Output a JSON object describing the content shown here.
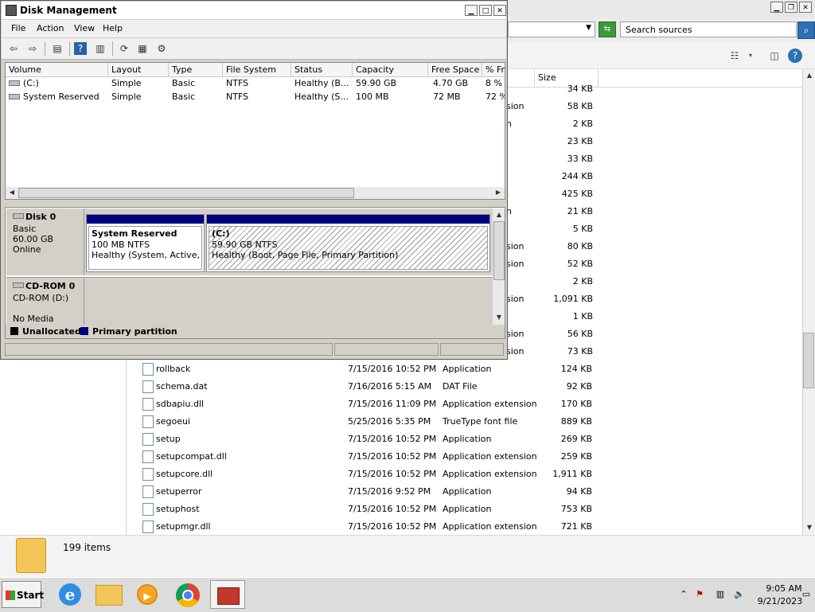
{
  "explorer": {
    "search_placeholder": "Search sources",
    "column_size": "Size",
    "item_count": "199 items",
    "side_rows": [
      {
        "type": "",
        "size": "34 KB"
      },
      {
        "type": "sion",
        "size": "58 KB"
      },
      {
        "type": "n",
        "size": "2 KB"
      },
      {
        "type": "",
        "size": "23 KB"
      },
      {
        "type": "",
        "size": "33 KB"
      },
      {
        "type": "",
        "size": "244 KB"
      },
      {
        "type": "",
        "size": "425 KB"
      },
      {
        "type": "n",
        "size": "21 KB"
      },
      {
        "type": "",
        "size": "5 KB"
      },
      {
        "type": "sion",
        "size": "80 KB"
      },
      {
        "type": "sion",
        "size": "52 KB"
      },
      {
        "type": "",
        "size": "2 KB"
      },
      {
        "type": "sion",
        "size": "1,091 KB"
      },
      {
        "type": "",
        "size": "1 KB"
      },
      {
        "type": "sion",
        "size": "56 KB"
      },
      {
        "type": "sion",
        "size": "73 KB"
      }
    ],
    "files": [
      {
        "name": "rollback",
        "date": "7/15/2016 10:52 PM",
        "type": "Application",
        "size": "124 KB"
      },
      {
        "name": "schema.dat",
        "date": "7/16/2016 5:15 AM",
        "type": "DAT File",
        "size": "92 KB"
      },
      {
        "name": "sdbapiu.dll",
        "date": "7/15/2016 11:09 PM",
        "type": "Application extension",
        "size": "170 KB"
      },
      {
        "name": "segoeui",
        "date": "5/25/2016 5:35 PM",
        "type": "TrueType font file",
        "size": "889 KB"
      },
      {
        "name": "setup",
        "date": "7/15/2016 10:52 PM",
        "type": "Application",
        "size": "269 KB"
      },
      {
        "name": "setupcompat.dll",
        "date": "7/15/2016 10:52 PM",
        "type": "Application extension",
        "size": "259 KB"
      },
      {
        "name": "setupcore.dll",
        "date": "7/15/2016 10:52 PM",
        "type": "Application extension",
        "size": "1,911 KB"
      },
      {
        "name": "setuperror",
        "date": "7/15/2016 9:52 PM",
        "type": "Application",
        "size": "94 KB"
      },
      {
        "name": "setuphost",
        "date": "7/15/2016 10:52 PM",
        "type": "Application",
        "size": "753 KB"
      },
      {
        "name": "setupmgr.dll",
        "date": "7/15/2016 10:52 PM",
        "type": "Application extension",
        "size": "721 KB"
      }
    ]
  },
  "disk_mgmt": {
    "title": "Disk Management",
    "menu": [
      "File",
      "Action",
      "View",
      "Help"
    ],
    "columns": [
      "Volume",
      "Layout",
      "Type",
      "File System",
      "Status",
      "Capacity",
      "Free Space",
      "% Fr"
    ],
    "volumes": [
      {
        "volume": "(C:)",
        "layout": "Simple",
        "type": "Basic",
        "fs": "NTFS",
        "status": "Healthy (B...",
        "capacity": "59.90 GB",
        "free": "4.70 GB",
        "pct": "8 %"
      },
      {
        "volume": "System Reserved",
        "layout": "Simple",
        "type": "Basic",
        "fs": "NTFS",
        "status": "Healthy (S...",
        "capacity": "100 MB",
        "free": "72 MB",
        "pct": "72 %"
      }
    ],
    "disk0": {
      "name": "Disk 0",
      "type": "Basic",
      "size": "60.00 GB",
      "state": "Online"
    },
    "partitions": [
      {
        "name": "System Reserved",
        "size": "100 MB NTFS",
        "status": "Healthy (System, Active, Pri"
      },
      {
        "name": "(C:)",
        "size": "59.90 GB NTFS",
        "status": "Healthy (Boot, Page File, Primary Partition)"
      }
    ],
    "cdrom": {
      "name": "CD-ROM 0",
      "type": "CD-ROM (D:)",
      "state": "No Media"
    },
    "legend": [
      {
        "label": "Unallocated",
        "color": "#000000"
      },
      {
        "label": "Primary partition",
        "color": "#000080"
      }
    ]
  },
  "taskbar": {
    "start_label": "Start",
    "time": "9:05 AM",
    "date": "9/21/2023"
  }
}
